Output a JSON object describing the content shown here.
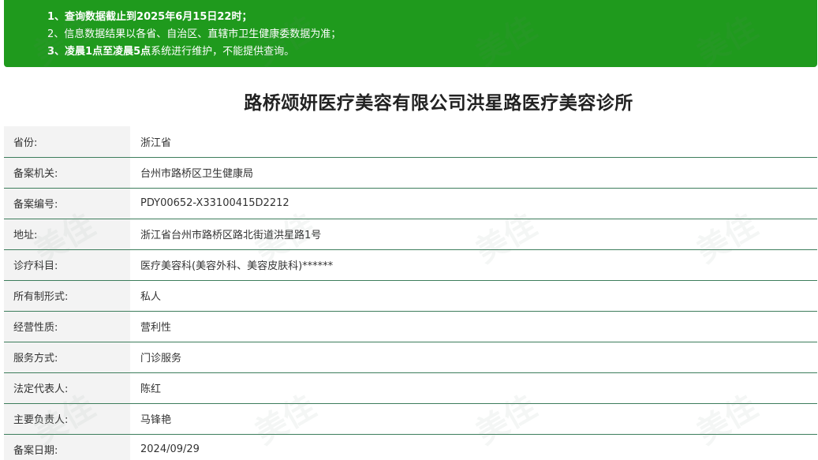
{
  "notice": {
    "line1_prefix": "1、查询数据截止到",
    "line1_date": "2025年6月15日22时",
    "line1_suffix": "；",
    "line2": "2、信息数据结果以各省、自治区、直辖市卫生健康委数据为准；",
    "line3_prefix": "3、",
    "line3_bold": "凌晨1点至凌晨5点",
    "line3_suffix": "系统进行维护，不能提供查询。"
  },
  "title": "路桥颂妍医疗美容有限公司洪星路医疗美容诊所",
  "rows": [
    {
      "label": "省份:",
      "value": "浙江省"
    },
    {
      "label": "备案机关:",
      "value": "台州市路桥区卫生健康局"
    },
    {
      "label": "备案编号:",
      "value": "PDY00652-X33100415D2212"
    },
    {
      "label": "地址:",
      "value": "浙江省台州市路桥区路北街道洪星路1号"
    },
    {
      "label": "诊疗科目:",
      "value": "医疗美容科(美容外科、美容皮肤科)******"
    },
    {
      "label": "所有制形式:",
      "value": "私人"
    },
    {
      "label": "经营性质:",
      "value": "营利性"
    },
    {
      "label": "服务方式:",
      "value": "门诊服务"
    },
    {
      "label": "法定代表人:",
      "value": "陈红"
    },
    {
      "label": "主要负责人:",
      "value": "马锋艳"
    },
    {
      "label": "备案日期:",
      "value": "2024/09/29"
    }
  ],
  "watermark": {
    "text": "美佳"
  },
  "colors": {
    "notice_bg": "#1f9a1d",
    "row_border": "#3d7d5c",
    "label_bg": "#f3f3f3"
  }
}
